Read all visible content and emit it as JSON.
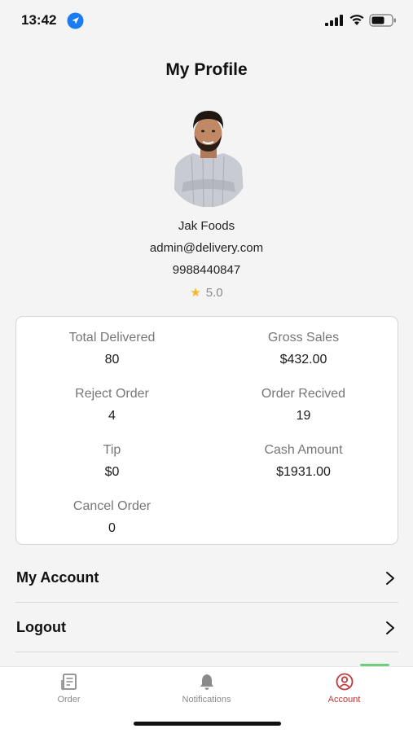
{
  "status_bar": {
    "time": "13:42"
  },
  "header": {
    "title": "My Profile"
  },
  "profile": {
    "name": "Jak Foods",
    "email": "admin@delivery.com",
    "phone": "9988440847",
    "rating": "5.0"
  },
  "stats": [
    {
      "label": "Total Delivered",
      "value": "80"
    },
    {
      "label": "Gross Sales",
      "value": "$432.00"
    },
    {
      "label": "Reject Order",
      "value": "4"
    },
    {
      "label": "Order Recived",
      "value": "19"
    },
    {
      "label": "Tip",
      "value": "$0"
    },
    {
      "label": "Cash Amount",
      "value": "$1931.00"
    },
    {
      "label": "Cancel Order",
      "value": "0"
    }
  ],
  "menu": [
    {
      "label": "My Account",
      "icon": "chevron-right-icon"
    },
    {
      "label": "Logout",
      "icon": "chevron-right-icon"
    }
  ],
  "tabs": [
    {
      "label": "Order",
      "icon": "receipt-icon"
    },
    {
      "label": "Notifications",
      "icon": "bell-icon"
    },
    {
      "label": "Account",
      "icon": "user-circle-icon",
      "active": true
    }
  ],
  "colors": {
    "accent": "#c0393b",
    "star": "#f4b728",
    "location": "#1a7cf2"
  }
}
